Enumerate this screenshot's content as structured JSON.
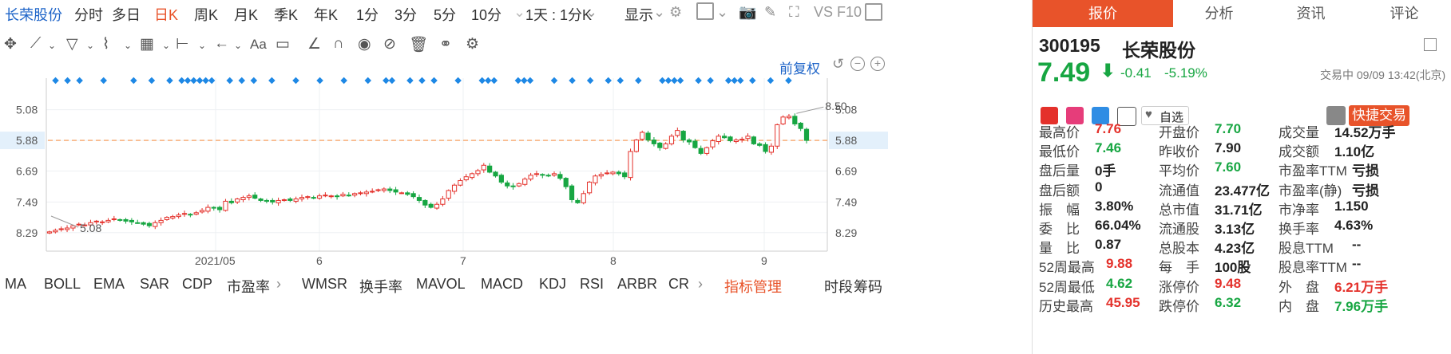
{
  "toolbar": {
    "stock_name": "长荣股份",
    "periods": [
      "分时",
      "多日",
      "日K",
      "周K",
      "月K",
      "季K",
      "年K",
      "1分",
      "3分",
      "5分",
      "10分"
    ],
    "active_period": "日K",
    "period_select": "1天 : 1分K",
    "display_label": "显示",
    "vs_label": "VS",
    "f10_label": "F10"
  },
  "chart": {
    "adjust_label": "前复权",
    "y_ticks": [
      "8.29",
      "7.49",
      "6.69",
      "5.88",
      "5.08"
    ],
    "current_price_tag": "7.49",
    "x_ticks": [
      "2021/05",
      "6",
      "7",
      "8",
      "9"
    ],
    "annotation_high": "8.50",
    "annotation_low": "5.08"
  },
  "chart_data": {
    "type": "candlestick",
    "ylim": [
      4.7,
      8.7
    ],
    "y_ticks": [
      5.08,
      5.88,
      6.69,
      7.49,
      8.29
    ],
    "x_ticks": [
      "2021/05",
      "6",
      "7",
      "8",
      "9"
    ],
    "current_price": 7.49,
    "max_label": 8.5,
    "min_label": 5.08,
    "colors": {
      "up": "#e4312b",
      "down": "#17a642",
      "current_line": "#f5944a",
      "marker": "#1e88e5"
    },
    "closes": [
      5.1,
      5.14,
      5.18,
      5.2,
      5.26,
      5.3,
      5.28,
      5.34,
      5.38,
      5.36,
      5.4,
      5.44,
      5.42,
      5.38,
      5.36,
      5.34,
      5.3,
      5.26,
      5.34,
      5.4,
      5.48,
      5.5,
      5.54,
      5.58,
      5.56,
      5.6,
      5.66,
      5.74,
      5.72,
      5.68,
      5.9,
      5.86,
      5.96,
      6.0,
      6.04,
      5.98,
      5.92,
      5.9,
      5.88,
      5.92,
      5.94,
      5.92,
      5.96,
      6.0,
      6.02,
      5.98,
      6.04,
      6.06,
      6.04,
      6.02,
      6.08,
      6.06,
      6.1,
      6.12,
      6.14,
      6.16,
      6.2,
      6.22,
      6.18,
      6.14,
      6.12,
      6.08,
      6.02,
      5.92,
      5.8,
      5.74,
      5.82,
      5.96,
      6.18,
      6.32,
      6.44,
      6.54,
      6.62,
      6.7,
      6.84,
      6.66,
      6.56,
      6.4,
      6.3,
      6.28,
      6.36,
      6.48,
      6.58,
      6.62,
      6.58,
      6.56,
      6.62,
      6.5,
      6.28,
      5.94,
      5.86,
      6.1,
      6.4,
      6.56,
      6.6,
      6.64,
      6.66,
      6.62,
      6.54,
      7.2,
      7.5,
      7.7,
      7.5,
      7.4,
      7.3,
      7.4,
      7.6,
      7.75,
      7.5,
      7.45,
      7.3,
      7.15,
      7.3,
      7.48,
      7.6,
      7.56,
      7.48,
      7.5,
      7.52,
      7.6,
      7.4,
      7.36,
      7.2,
      7.34,
      7.9,
      8.1,
      8.12,
      7.92,
      7.8,
      7.49
    ],
    "marker_positions": [
      1,
      3,
      5,
      9,
      14,
      17,
      20,
      22,
      23,
      24,
      25,
      26,
      27,
      30,
      32,
      34,
      37,
      41,
      45,
      49,
      53,
      56,
      57,
      60,
      62,
      64,
      68,
      72,
      73,
      74,
      78,
      79,
      80,
      84,
      87,
      90,
      93,
      95,
      98,
      102,
      103,
      104,
      105,
      108,
      110,
      113,
      114,
      115,
      117,
      120,
      123
    ]
  },
  "indicators": {
    "items": [
      "MA",
      "BOLL",
      "EMA",
      "SAR",
      "CDP",
      "市盈率",
      "WMSR",
      "换手率",
      "MAVOL",
      "MACD",
      "KDJ",
      "RSI",
      "ARBR",
      "CR"
    ],
    "manage_label": "指标管理",
    "right_items": [
      "时段",
      "筹码"
    ]
  },
  "panel": {
    "tabs": [
      "报价",
      "分析",
      "资讯",
      "评论"
    ],
    "code": "300195",
    "name": "长荣股份",
    "price": "7.49",
    "change": "-0.41",
    "change_pct": "-5.19%",
    "status": "交易中 09/09 13:42(北京)",
    "watch_label": "自选",
    "trade_label": "快捷交易",
    "quotes": [
      {
        "label": "最高价",
        "value": "7.76",
        "color": "red"
      },
      {
        "label": "开盘价",
        "value": "7.70",
        "color": "green"
      },
      {
        "label": "成交量",
        "value": "14.52万手",
        "color": "dark"
      },
      {
        "label": "最低价",
        "value": "7.46",
        "color": "green"
      },
      {
        "label": "昨收价",
        "value": "7.90",
        "color": "dark"
      },
      {
        "label": "成交额",
        "value": "1.10亿",
        "color": "dark"
      },
      {
        "label": "盘后量",
        "value": "0手",
        "color": "dark"
      },
      {
        "label": "平均价",
        "value": "7.60",
        "color": "green"
      },
      {
        "label": "市盈率TTM",
        "value": "亏损",
        "color": "dark"
      },
      {
        "label": "盘后额",
        "value": "0",
        "color": "dark"
      },
      {
        "label": "流通值",
        "value": "23.477亿",
        "color": "dark"
      },
      {
        "label": "市盈率(静)",
        "value": "亏损",
        "color": "dark"
      },
      {
        "label": "振　幅",
        "value": "3.80%",
        "color": "dark"
      },
      {
        "label": "总市值",
        "value": "31.71亿",
        "color": "dark"
      },
      {
        "label": "市净率",
        "value": "1.150",
        "color": "dark"
      },
      {
        "label": "委　比",
        "value": "66.04%",
        "color": "dark"
      },
      {
        "label": "流通股",
        "value": "3.13亿",
        "color": "dark"
      },
      {
        "label": "换手率",
        "value": "4.63%",
        "color": "dark"
      },
      {
        "label": "量　比",
        "value": "0.87",
        "color": "dark"
      },
      {
        "label": "总股本",
        "value": "4.23亿",
        "color": "dark"
      },
      {
        "label": "股息TTM",
        "value": "--",
        "color": "dark"
      },
      {
        "label": "52周最高",
        "value": "9.88",
        "color": "red"
      },
      {
        "label": "每　手",
        "value": "100股",
        "color": "dark"
      },
      {
        "label": "股息率TTM",
        "value": "--",
        "color": "dark"
      },
      {
        "label": "52周最低",
        "value": "4.62",
        "color": "green"
      },
      {
        "label": "涨停价",
        "value": "9.48",
        "color": "red"
      },
      {
        "label": "外　盘",
        "value": "6.21万手",
        "color": "red"
      },
      {
        "label": "历史最高",
        "value": "45.95",
        "color": "red"
      },
      {
        "label": "跌停价",
        "value": "6.32",
        "color": "green"
      },
      {
        "label": "内　盘",
        "value": "7.96万手",
        "color": "green"
      }
    ]
  }
}
